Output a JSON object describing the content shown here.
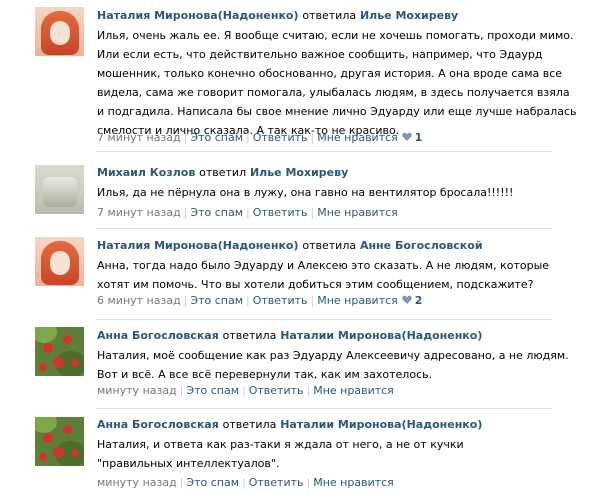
{
  "comments": [
    {
      "author": "Наталия Миронова(Надоненко)",
      "verb": "ответила",
      "target": "Илье Мохиреву",
      "text": "Илья, очень жаль ее. Я вообще считаю, если не хочешь помогать, проходи мимо. Или если есть, что действительно важное сообщить, например, что Эдаурд мошенник, только конечно обоснованно, другая история. А она вроде сама все видела, сама же говорит помогала, улыбалась людям, в здесь получается взяла и подгадила. Написала бы свое мнение лично Эдуарду или еще лучше набралась смелости и лично сказала. А так как-то не красиво.",
      "time": "7 минут назад",
      "spam": "Это спам",
      "reply": "Ответить",
      "like": "Мне нравится",
      "like_count": "1",
      "avatar": "red-haired-woman"
    },
    {
      "author": "Михаил Козлов",
      "verb": "ответил",
      "target": "Илье Мохиреву",
      "text": "Илья, да не пёрнула она в лужу, она гавно на вентилятор бросала!!!!!!",
      "time": "7 минут назад",
      "spam": "Это спам",
      "reply": "Ответить",
      "like": "Мне нравится",
      "like_count": "",
      "avatar": "grey-photo"
    },
    {
      "author": "Наталия Миронова(Надоненко)",
      "verb": "ответила",
      "target": "Анне Богословской",
      "text": "Анна, тогда надо было Эдуарду и Алексею это сказать. А не людям, которые хотят им помочь. Что вы хотели добиться этим сообщением, подскажите?",
      "time": "6 минут назад",
      "spam": "Это спам",
      "reply": "Ответить",
      "like": "Мне нравится",
      "like_count": "2",
      "avatar": "red-haired-woman"
    },
    {
      "author": "Анна Богословская",
      "verb": "ответила",
      "target": "Наталии Миронова(Надоненко)",
      "text": "Наталия, моё сообщение как раз Эдуарду Алексеевичу адресовано, а не людям. Вот и всё. А все всё перевернули так, как им захотелось.",
      "time": "минуту назад",
      "spam": "Это спам",
      "reply": "Ответить",
      "like": "Мне нравится",
      "like_count": "",
      "avatar": "flowers"
    },
    {
      "author": "Анна Богословская",
      "verb": "ответила",
      "target": "Наталии Миронова(Надоненко)",
      "text": "Наталия, и ответа как раз-таки я ждала от него, а не от кучки \"правильных интеллектуалов\".",
      "time": "минуту назад",
      "spam": "Это спам",
      "reply": "Ответить",
      "like": "Мне нравится",
      "like_count": "",
      "avatar": "flowers"
    }
  ],
  "colors": {
    "link": "#2b587a",
    "meta": "#777777",
    "heart": "#7c97b7",
    "divider": "#dde2e9"
  },
  "icons": {
    "heart": "heart-icon"
  }
}
